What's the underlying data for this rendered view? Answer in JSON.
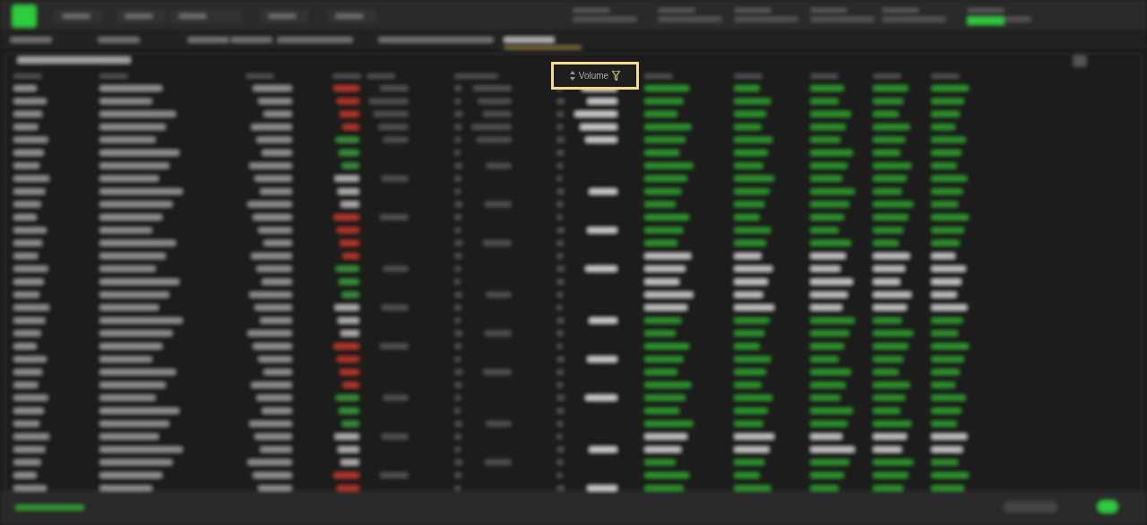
{
  "highlighted_column": {
    "label": "Volume"
  }
}
